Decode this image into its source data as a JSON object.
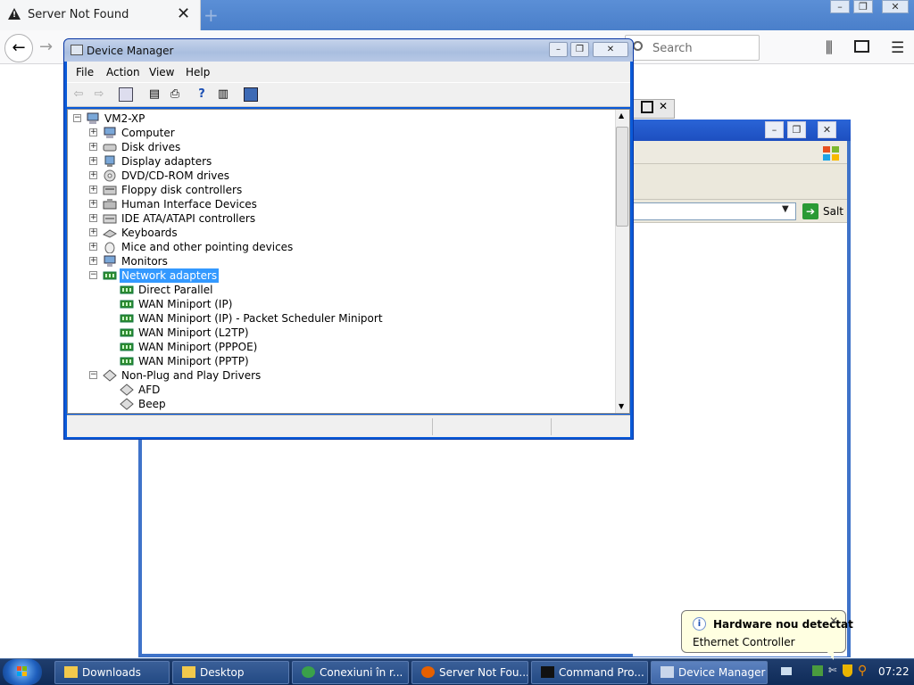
{
  "firefox": {
    "tab_title": "Server Not Found",
    "search_placeholder": "Search"
  },
  "backdrop_window": {
    "go_label": "Salt"
  },
  "device_manager": {
    "title": "Device Manager",
    "menu": [
      "File",
      "Action",
      "View",
      "Help"
    ],
    "tree": [
      {
        "label": "VM2-XP",
        "level": 0,
        "expander": "-",
        "icon": "computer-icon"
      },
      {
        "label": "Computer",
        "level": 1,
        "expander": "+",
        "icon": "computer-icon"
      },
      {
        "label": "Disk drives",
        "level": 1,
        "expander": "+",
        "icon": "disk-drive-icon"
      },
      {
        "label": "Display adapters",
        "level": 1,
        "expander": "+",
        "icon": "display-adapter-icon"
      },
      {
        "label": "DVD/CD-ROM drives",
        "level": 1,
        "expander": "+",
        "icon": "dvd-drive-icon"
      },
      {
        "label": "Floppy disk controllers",
        "level": 1,
        "expander": "+",
        "icon": "floppy-controller-icon"
      },
      {
        "label": "Human Interface Devices",
        "level": 1,
        "expander": "+",
        "icon": "hid-icon"
      },
      {
        "label": "IDE ATA/ATAPI controllers",
        "level": 1,
        "expander": "+",
        "icon": "ide-controller-icon"
      },
      {
        "label": "Keyboards",
        "level": 1,
        "expander": "+",
        "icon": "keyboard-icon"
      },
      {
        "label": "Mice and other pointing devices",
        "level": 1,
        "expander": "+",
        "icon": "mouse-icon"
      },
      {
        "label": "Monitors",
        "level": 1,
        "expander": "+",
        "icon": "monitor-icon"
      },
      {
        "label": "Network adapters",
        "level": 1,
        "expander": "-",
        "icon": "network-adapter-icon",
        "selected": true
      },
      {
        "label": "Direct Parallel",
        "level": 2,
        "icon": "network-adapter-icon"
      },
      {
        "label": "WAN Miniport (IP)",
        "level": 2,
        "icon": "network-adapter-icon"
      },
      {
        "label": "WAN Miniport (IP) - Packet Scheduler Miniport",
        "level": 2,
        "icon": "network-adapter-icon"
      },
      {
        "label": "WAN Miniport (L2TP)",
        "level": 2,
        "icon": "network-adapter-icon"
      },
      {
        "label": "WAN Miniport (PPPOE)",
        "level": 2,
        "icon": "network-adapter-icon"
      },
      {
        "label": "WAN Miniport (PPTP)",
        "level": 2,
        "icon": "network-adapter-icon"
      },
      {
        "label": "Non-Plug and Play Drivers",
        "level": 1,
        "expander": "-",
        "icon": "driver-icon"
      },
      {
        "label": "AFD",
        "level": 2,
        "icon": "driver-icon"
      },
      {
        "label": "Beep",
        "level": 2,
        "icon": "driver-icon"
      }
    ]
  },
  "taskbar": {
    "buttons": [
      {
        "label": "Downloads",
        "icon": "folder-icon"
      },
      {
        "label": "Desktop",
        "icon": "folder-icon"
      },
      {
        "label": "Conexiuni în r...",
        "icon": "network-connections-icon"
      },
      {
        "label": "Server Not Fou...",
        "icon": "firefox-icon"
      },
      {
        "label": "Command Pro...",
        "icon": "command-prompt-icon"
      },
      {
        "label": "Device Manager",
        "icon": "device-manager-icon",
        "active": true
      }
    ],
    "clock": "07:22"
  },
  "balloon": {
    "title": "Hardware nou detectat",
    "message": "Ethernet Controller"
  },
  "colors": {
    "selection": "#3399ff",
    "taskbar": "#1f3d6d",
    "xp_blue": "#0a5ad8"
  }
}
